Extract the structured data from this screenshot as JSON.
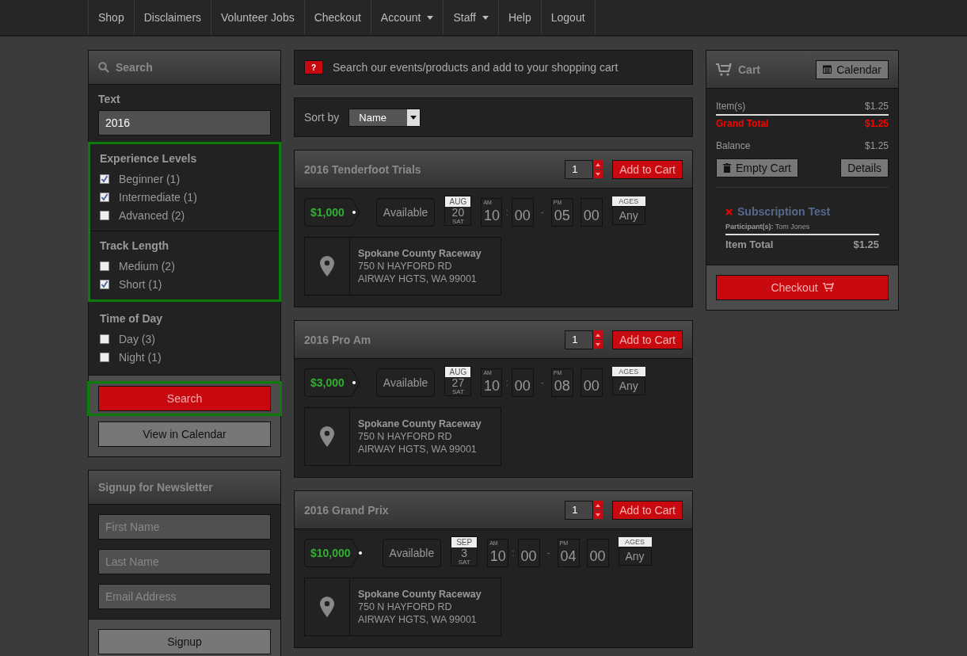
{
  "nav": {
    "items": [
      {
        "label": "Shop",
        "dropdown": false
      },
      {
        "label": "Disclaimers",
        "dropdown": false
      },
      {
        "label": "Volunteer Jobs",
        "dropdown": false
      },
      {
        "label": "Checkout",
        "dropdown": false
      },
      {
        "label": "Account",
        "dropdown": true
      },
      {
        "label": "Staff",
        "dropdown": true
      },
      {
        "label": "Help",
        "dropdown": false
      },
      {
        "label": "Logout",
        "dropdown": false
      }
    ]
  },
  "search_panel": {
    "title": "Search",
    "text_label": "Text",
    "text_value": "2016",
    "sections": [
      {
        "highlighted": true,
        "groups": [
          {
            "title": "Experience Levels",
            "options": [
              {
                "label": "Beginner (1)",
                "checked": true
              },
              {
                "label": "Intermediate (1)",
                "checked": true
              },
              {
                "label": "Advanced (2)",
                "checked": false
              }
            ]
          },
          {
            "title": "Track Length",
            "options": [
              {
                "label": "Medium (2)",
                "checked": false
              },
              {
                "label": "Short (1)",
                "checked": true
              }
            ]
          }
        ]
      },
      {
        "highlighted": false,
        "groups": [
          {
            "title": "Time of Day",
            "options": [
              {
                "label": "Day (3)",
                "checked": false
              },
              {
                "label": "Night (1)",
                "checked": false
              }
            ]
          }
        ]
      }
    ],
    "search_button": {
      "label": "Search",
      "highlighted": true
    },
    "calendar_button": "View in Calendar"
  },
  "newsletter": {
    "title": "Signup for Newsletter",
    "fields": [
      {
        "placeholder": "First Name"
      },
      {
        "placeholder": "Last Name"
      },
      {
        "placeholder": "Email Address"
      }
    ],
    "button": "Signup"
  },
  "info": {
    "badge": "?",
    "text": "Search our events/products and add to your shopping cart"
  },
  "sort": {
    "label": "Sort by",
    "value": "Name"
  },
  "events": [
    {
      "title": "2016 Tenderfoot Trials",
      "quantity": "1",
      "add_label": "Add to Cart",
      "price": "$1,000",
      "status": "Available",
      "month": "AUG",
      "day": "20",
      "weekday": "SAT",
      "start": {
        "period": "AM",
        "hour": "10",
        "minute": "00"
      },
      "time_separator": ":",
      "range_separator": "-",
      "end": {
        "period": "PM",
        "hour": "05",
        "minute": "00"
      },
      "ages_label": "AGES",
      "ages_value": "Any",
      "venue": "Spokane County Raceway",
      "address_lines": [
        "750 N HAYFORD RD",
        "AIRWAY HGTS, WA 99001"
      ]
    },
    {
      "title": "2016 Pro Am",
      "quantity": "1",
      "add_label": "Add to Cart",
      "price": "$3,000",
      "status": "Available",
      "month": "AUG",
      "day": "27",
      "weekday": "SAT",
      "start": {
        "period": "AM",
        "hour": "10",
        "minute": "00"
      },
      "time_separator": ":",
      "range_separator": "-",
      "end": {
        "period": "PM",
        "hour": "08",
        "minute": "00"
      },
      "ages_label": "AGES",
      "ages_value": "Any",
      "venue": "Spokane County Raceway",
      "address_lines": [
        "750 N HAYFORD RD",
        "AIRWAY HGTS, WA 99001"
      ]
    },
    {
      "title": "2016 Grand Prix",
      "quantity": "1",
      "add_label": "Add to Cart",
      "price": "$10,000",
      "status": "Available",
      "month": "SEP",
      "day": "3",
      "weekday": "SAT",
      "start": {
        "period": "AM",
        "hour": "10",
        "minute": "00"
      },
      "time_separator": ":",
      "range_separator": "-",
      "end": {
        "period": "PM",
        "hour": "04",
        "minute": "00"
      },
      "ages_label": "AGES",
      "ages_value": "Any",
      "venue": "Spokane County Raceway",
      "address_lines": [
        "750 N HAYFORD RD",
        "AIRWAY HGTS, WA 99001"
      ]
    }
  ],
  "cart": {
    "title": "Cart",
    "calendar_button": "Calendar",
    "rows": [
      {
        "label": "Item(s)",
        "amount": "$1.25",
        "kind": "subtotal"
      },
      {
        "label": "Grand Total",
        "amount": "$1.25",
        "kind": "total"
      },
      {
        "label": "Balance",
        "amount": "$1.25",
        "kind": "normal"
      }
    ],
    "empty_button": "Empty Cart",
    "details_button": "Details",
    "items": [
      {
        "name": "Subscription Test",
        "participants": "**Participant(s):** Tom Jones",
        "total_label": "Item Total",
        "total": "$1.25"
      }
    ],
    "checkout": "Checkout"
  }
}
